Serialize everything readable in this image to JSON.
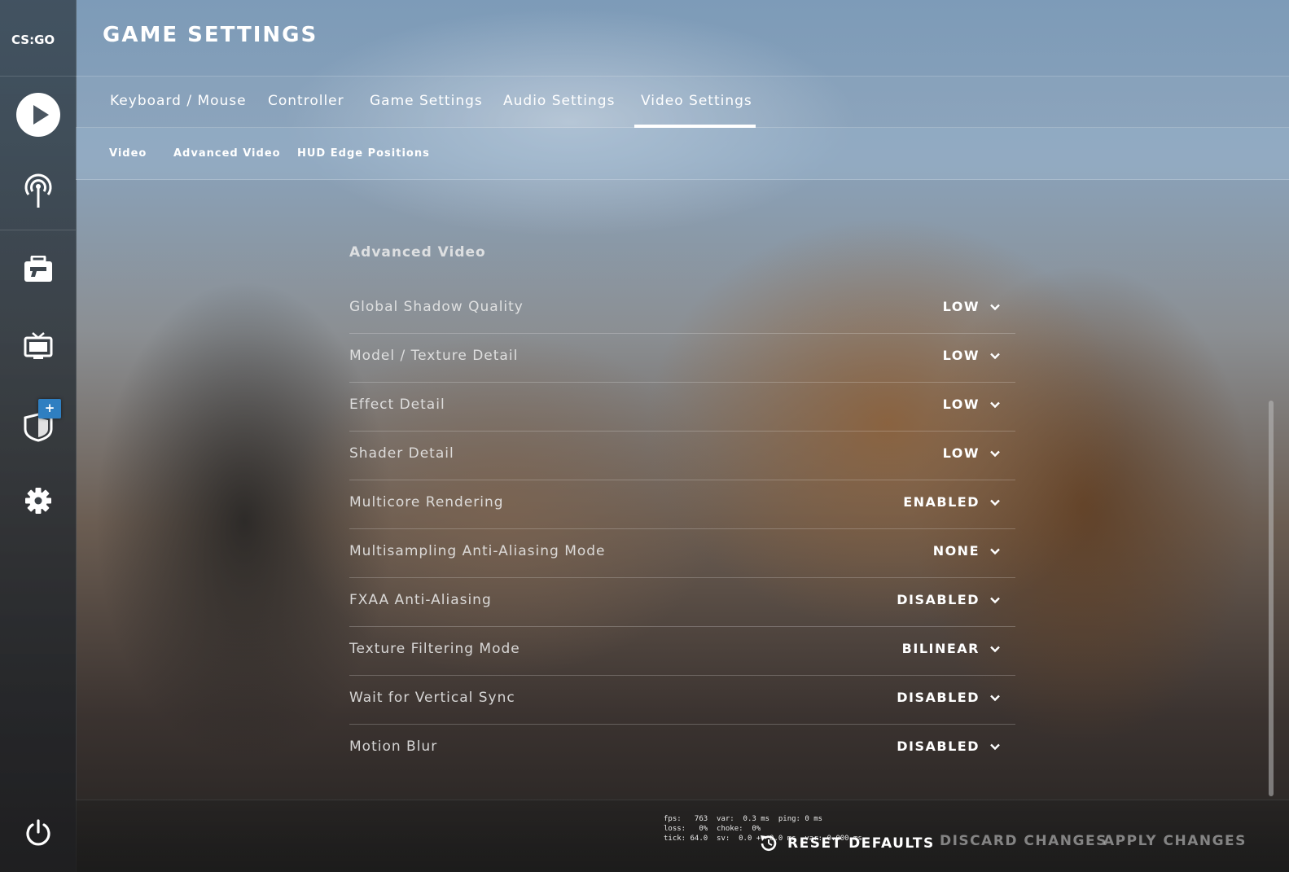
{
  "sidebar": {
    "logo": "CS:GO",
    "items": [
      {
        "icon": "play-icon"
      },
      {
        "icon": "broadcast-icon"
      },
      {
        "icon": "inventory-icon"
      },
      {
        "icon": "tv-icon"
      },
      {
        "icon": "shield-icon",
        "badge": "+"
      },
      {
        "icon": "gear-icon"
      },
      {
        "icon": "power-icon"
      }
    ]
  },
  "header": {
    "title": "GAME SETTINGS"
  },
  "tabs": [
    {
      "label": "Keyboard / Mouse"
    },
    {
      "label": "Controller"
    },
    {
      "label": "Game Settings"
    },
    {
      "label": "Audio Settings"
    },
    {
      "label": "Video Settings",
      "active": true
    }
  ],
  "subtabs": [
    {
      "label": "Video"
    },
    {
      "label": "Advanced Video"
    },
    {
      "label": "HUD Edge Positions"
    }
  ],
  "section": {
    "heading": "Advanced Video",
    "settings": [
      {
        "label": "Global Shadow Quality",
        "value": "LOW"
      },
      {
        "label": "Model / Texture Detail",
        "value": "LOW"
      },
      {
        "label": "Effect Detail",
        "value": "LOW"
      },
      {
        "label": "Shader Detail",
        "value": "LOW"
      },
      {
        "label": "Multicore Rendering",
        "value": "ENABLED"
      },
      {
        "label": "Multisampling Anti-Aliasing Mode",
        "value": "NONE"
      },
      {
        "label": "FXAA Anti-Aliasing",
        "value": "DISABLED"
      },
      {
        "label": "Texture Filtering Mode",
        "value": "BILINEAR"
      },
      {
        "label": "Wait for Vertical Sync",
        "value": "DISABLED"
      },
      {
        "label": "Motion Blur",
        "value": "DISABLED"
      }
    ]
  },
  "footer": {
    "reset_label": "RESET DEFAULTS",
    "discard_label": "DISCARD CHANGES",
    "apply_label": "APPLY CHANGES"
  },
  "netgraph": {
    "line1": "fps:   763  var:  0.3 ms  ping: 0 ms",
    "line2": "loss:   0%  choke:  0%",
    "line3": "tick: 64.0  sv:  0.0 +- 0.0 ms  var: 0.000 ms"
  },
  "colors": {
    "text": "#ffffff",
    "muted": "#c8c8c8",
    "badge": "#2f7fc1"
  }
}
